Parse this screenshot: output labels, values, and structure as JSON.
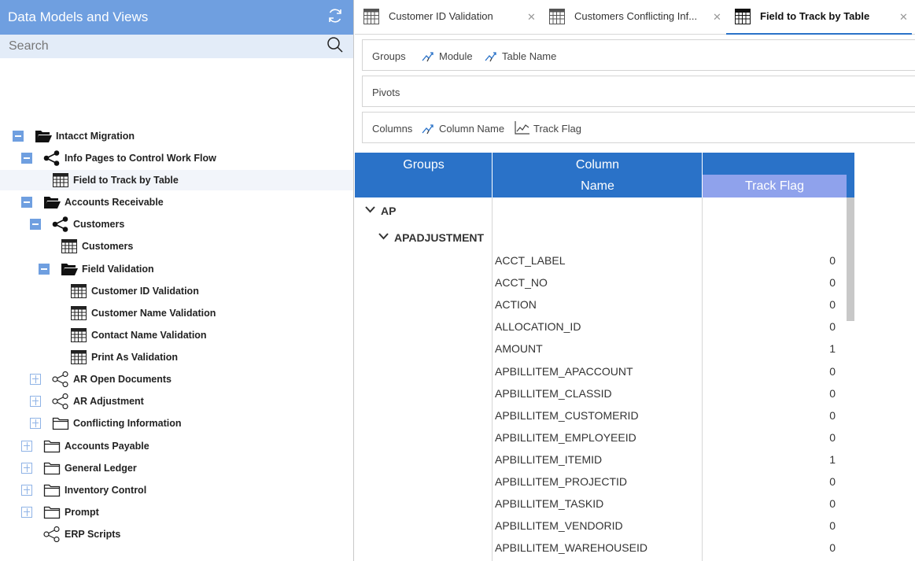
{
  "left_panel": {
    "title": "Data Models and Views",
    "search_placeholder": "Search",
    "tree": [
      {
        "label": "Intacct Migration",
        "level": 0,
        "toggle": "minus",
        "icon": "folder-open"
      },
      {
        "label": "Info Pages to Control Work Flow",
        "level": 1,
        "toggle": "minus",
        "icon": "share"
      },
      {
        "label": "Field to Track by Table",
        "level": 2,
        "toggle": "none",
        "icon": "table",
        "selected": true
      },
      {
        "label": "Accounts Receivable",
        "level": 1,
        "toggle": "minus",
        "icon": "folder-open"
      },
      {
        "label": "Customers",
        "level": 2,
        "toggle": "minus",
        "icon": "share"
      },
      {
        "label": "Customers",
        "level": 3,
        "toggle": "none",
        "icon": "table"
      },
      {
        "label": "Field Validation",
        "level": 3,
        "toggle": "minus",
        "icon": "folder-open"
      },
      {
        "label": "Customer ID Validation",
        "level": 4,
        "toggle": "none",
        "icon": "table"
      },
      {
        "label": "Customer Name Validation",
        "level": 4,
        "toggle": "none",
        "icon": "table"
      },
      {
        "label": "Contact Name Validation",
        "level": 4,
        "toggle": "none",
        "icon": "table"
      },
      {
        "label": "Print As Validation",
        "level": 4,
        "toggle": "none",
        "icon": "table"
      },
      {
        "label": "AR Open Documents",
        "level": 2,
        "toggle": "plus",
        "icon": "share-outline"
      },
      {
        "label": "AR Adjustment",
        "level": 2,
        "toggle": "plus",
        "icon": "share-outline"
      },
      {
        "label": "Conflicting Information",
        "level": 2,
        "toggle": "plus",
        "icon": "folder"
      },
      {
        "label": "Accounts Payable",
        "level": 1,
        "toggle": "plus",
        "icon": "folder"
      },
      {
        "label": "General Ledger",
        "level": 1,
        "toggle": "plus",
        "icon": "folder"
      },
      {
        "label": "Inventory Control",
        "level": 1,
        "toggle": "plus",
        "icon": "folder"
      },
      {
        "label": "Prompt",
        "level": 1,
        "toggle": "plus",
        "icon": "folder"
      },
      {
        "label": "ERP Scripts",
        "level": 1,
        "toggle": "none",
        "icon": "share-outline"
      }
    ]
  },
  "tabs": [
    {
      "label": "Customer ID Validation",
      "active": false
    },
    {
      "label": "Customers Conflicting Inf...",
      "active": false
    },
    {
      "label": "Field to Track by Table",
      "active": true
    }
  ],
  "zones": {
    "groups": {
      "label": "Groups",
      "chips": [
        "Module",
        "Table Name"
      ]
    },
    "pivots": {
      "label": "Pivots",
      "chips": []
    },
    "columns": {
      "label": "Columns",
      "chips": [
        "Column Name",
        "Track Flag"
      ]
    }
  },
  "grid": {
    "headers": {
      "groups": "Groups",
      "column_line1": "Column",
      "column_line2": "Name",
      "track_flag": "Track Flag"
    },
    "group_rows": [
      {
        "label": "AP",
        "level": 0
      },
      {
        "label": "APADJUSTMENT",
        "level": 1
      }
    ],
    "rows": [
      {
        "column_name": "ACCT_LABEL",
        "track_flag": "0"
      },
      {
        "column_name": "ACCT_NO",
        "track_flag": "0"
      },
      {
        "column_name": "ACTION",
        "track_flag": "0"
      },
      {
        "column_name": "ALLOCATION_ID",
        "track_flag": "0"
      },
      {
        "column_name": "AMOUNT",
        "track_flag": "1"
      },
      {
        "column_name": "APBILLITEM_APACCOUNT",
        "track_flag": "0"
      },
      {
        "column_name": "APBILLITEM_CLASSID",
        "track_flag": "0"
      },
      {
        "column_name": "APBILLITEM_CUSTOMERID",
        "track_flag": "0"
      },
      {
        "column_name": "APBILLITEM_EMPLOYEEID",
        "track_flag": "0"
      },
      {
        "column_name": "APBILLITEM_ITEMID",
        "track_flag": "1"
      },
      {
        "column_name": "APBILLITEM_PROJECTID",
        "track_flag": "0"
      },
      {
        "column_name": "APBILLITEM_TASKID",
        "track_flag": "0"
      },
      {
        "column_name": "APBILLITEM_VENDORID",
        "track_flag": "0"
      },
      {
        "column_name": "APBILLITEM_WAREHOUSEID",
        "track_flag": "0"
      }
    ]
  },
  "colors": {
    "header_blue": "#6f9fe0",
    "grid_blue": "#2a72c8",
    "track_flag_header": "#8fa2ec"
  }
}
